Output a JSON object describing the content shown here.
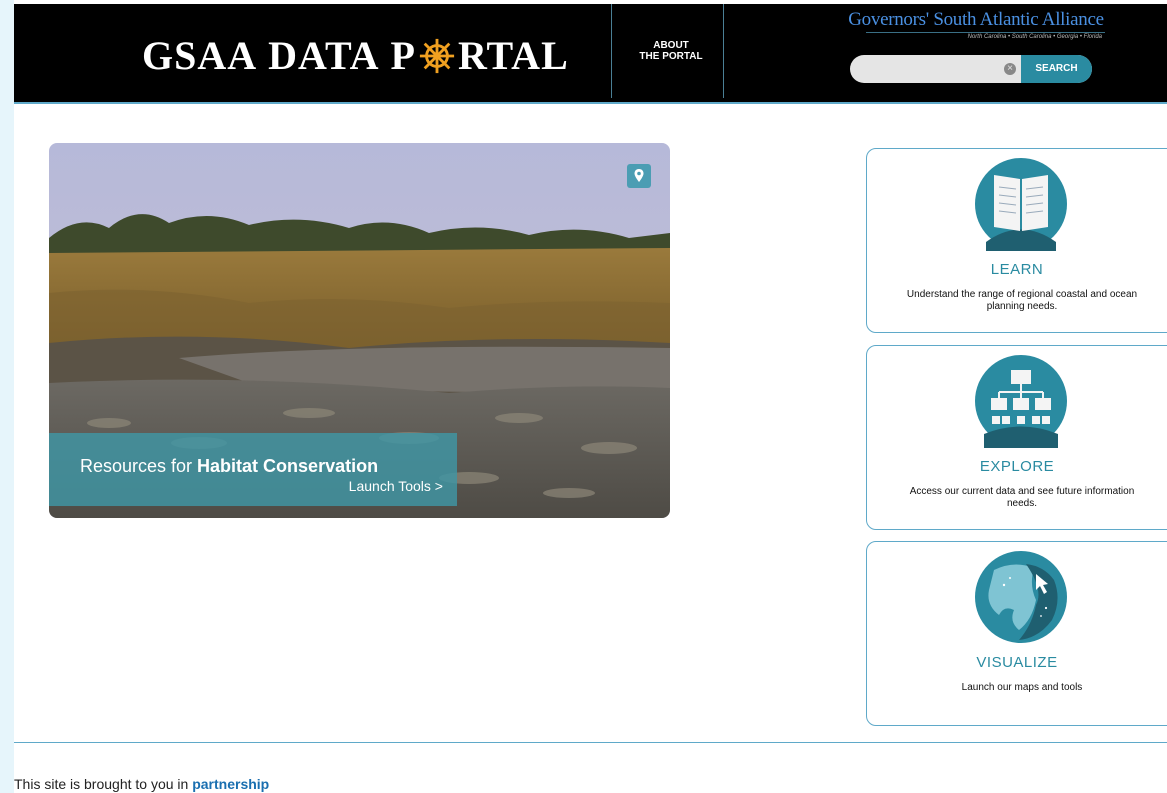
{
  "header": {
    "logo_part1": "GSAA",
    "logo_part2": "DATA",
    "logo_part3": "P",
    "logo_part4": "RTAL",
    "about_line1": "ABOUT",
    "about_line2": "THE PORTAL",
    "alliance_title": "Governors' South Atlantic Alliance",
    "alliance_states": "North Carolina • South Carolina • Georgia • Florida",
    "search_placeholder": "",
    "search_button": "SEARCH"
  },
  "hero": {
    "caption_prefix": "Resources for ",
    "caption_bold": "Habitat Conservation",
    "link": "Launch Tools >",
    "pin_icon": "map-pin-icon"
  },
  "cards": [
    {
      "title": "LEARN",
      "description": "Understand the range of regional coastal and ocean planning needs.",
      "icon": "open-book-icon"
    },
    {
      "title": "EXPLORE",
      "description": "Access our current data and see future information needs.",
      "icon": "hierarchy-chart-icon"
    },
    {
      "title": "VISUALIZE",
      "description": "Launch our maps and tools",
      "icon": "map-globe-icon"
    }
  ],
  "footer": {
    "text": "This site is brought to you in ",
    "link": "partnership"
  },
  "colors": {
    "accent": "#2a8ba1",
    "border": "#5fa9c9",
    "header_bg": "#000000"
  }
}
